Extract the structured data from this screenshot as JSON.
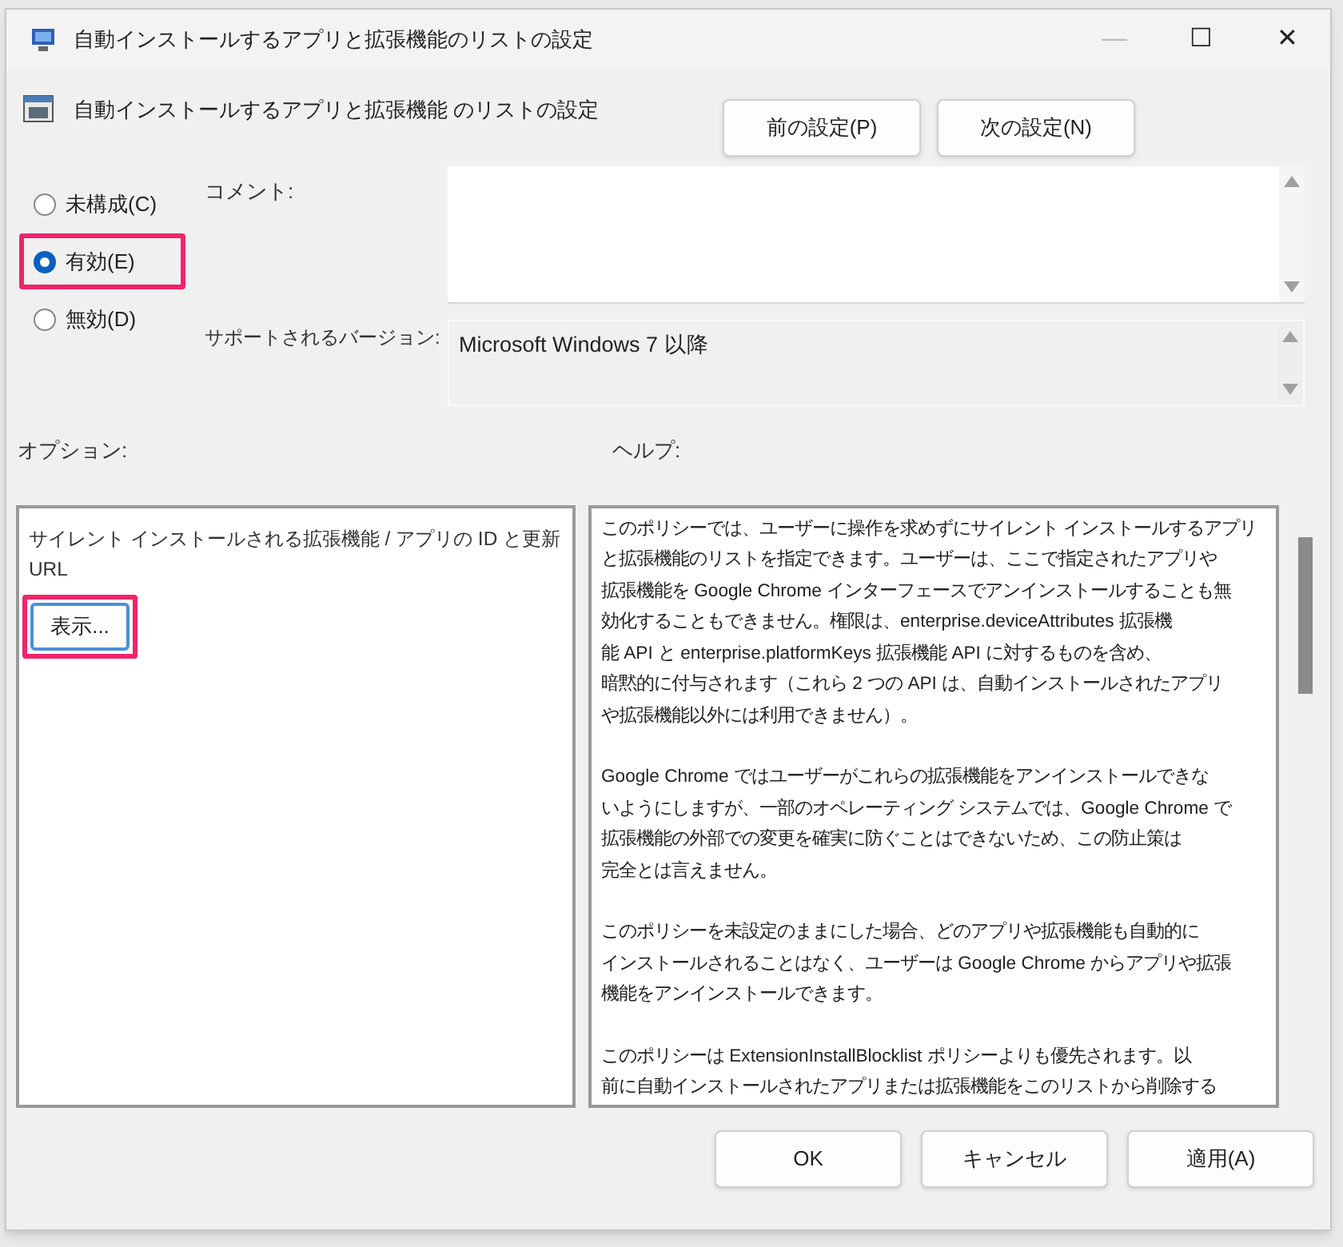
{
  "window": {
    "title": "自動インストールするアプリと拡張機能のリストの設定",
    "controls": [
      "—",
      "☐",
      "✕"
    ]
  },
  "policy_title": "自動インストールするアプリと拡張機能 のリストの設定",
  "nav_buttons": [
    "前の設定(P)",
    "次の設定(N)"
  ],
  "state_options": [
    {
      "label": "未構成(C)",
      "selected": false,
      "highlighted": false
    },
    {
      "label": "有効(E)",
      "selected": true,
      "highlighted": true
    },
    {
      "label": "無効(D)",
      "selected": false,
      "highlighted": false
    }
  ],
  "comment": {
    "label": "コメント:"
  },
  "supported": {
    "label": "サポートされるバージョン:",
    "value": "Microsoft Windows 7 以降"
  },
  "options": {
    "label": "オプション:",
    "description": "サイレント インストールされる拡張機能 / アプリの ID と更新 URL",
    "show_button": {
      "label": "表示...",
      "highlighted": true
    }
  },
  "help": {
    "label": "ヘルプ:",
    "paragraphs": [
      [
        "このポリシーでは、ユーザーに操作を求めずにサイレント インストールするアプリ",
        "と拡張機能のリストを指定できます。ユーザーは、ここで指定されたアプリや",
        "拡張機能を Google Chrome インターフェースでアンインストールすることも無",
        "効化することもできません。権限は、enterprise.deviceAttributes 拡張機",
        "能 API と enterprise.platformKeys 拡張機能 API に対するものを含め、",
        "暗黙的に付与されます（これら 2 つの API は、自動インストールされたアプリ",
        "や拡張機能以外には利用できません）。"
      ],
      [
        "Google Chrome ではユーザーがこれらの拡張機能をアンインストールできな",
        "いようにしますが、一部のオペレーティング システムでは、Google Chrome で",
        "拡張機能の外部での変更を確実に防ぐことはできないため、この防止策は",
        "完全とは言えません。"
      ],
      [
        "このポリシーを未設定のままにした場合、どのアプリや拡張機能も自動的に",
        "インストールされることはなく、ユーザーは Google Chrome からアプリや拡張",
        "機能をアンインストールできます。"
      ],
      [
        "このポリシーは ExtensionInstallBlocklist ポリシーよりも優先されます。以",
        "前に自動インストールされたアプリまたは拡張機能をこのリストから削除する"
      ]
    ]
  },
  "footer_buttons": [
    "OK",
    "キャンセル",
    "適用(A)"
  ]
}
